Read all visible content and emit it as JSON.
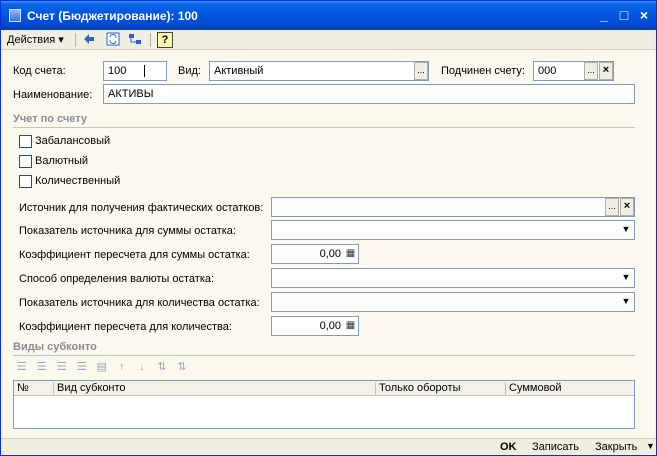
{
  "window": {
    "title": "Счет (Бюджетирование): 100",
    "min": "_",
    "max": "□",
    "close": "×"
  },
  "toolbar": {
    "actions": "Действия",
    "actions_arrow": "▾",
    "help": "?"
  },
  "form": {
    "account_code_label": "Код счета:",
    "account_code_value": "100",
    "kind_label": "Вид:",
    "kind_value": "Активный",
    "parent_label": "Подчинен счету:",
    "parent_value": "000",
    "name_label": "Наименование:",
    "name_value": "АКТИВЫ"
  },
  "accounting": {
    "section_title": "Учет по счету",
    "off_balance": "Забалансовый",
    "currency": "Валютный",
    "quantity": "Количественный",
    "source_label": "Источник для получения фактических остатков:",
    "source_value": "",
    "sum_indicator_label": "Показатель источника для суммы остатка:",
    "sum_coef_label": "Коэффициент пересчета для суммы остатка:",
    "sum_coef_value": "0,00",
    "currency_method_label": "Способ определения валюты остатка:",
    "qty_indicator_label": "Показатель источника для количества остатка:",
    "qty_coef_label": "Коэффициент пересчета для количества:",
    "qty_coef_value": "0,00"
  },
  "subconto": {
    "section_title": "Виды субконто",
    "columns": [
      "№",
      "Вид субконто",
      "Только обороты",
      "Суммовой"
    ]
  },
  "footer": {
    "ok": "OK",
    "save": "Записать",
    "close": "Закрыть"
  }
}
